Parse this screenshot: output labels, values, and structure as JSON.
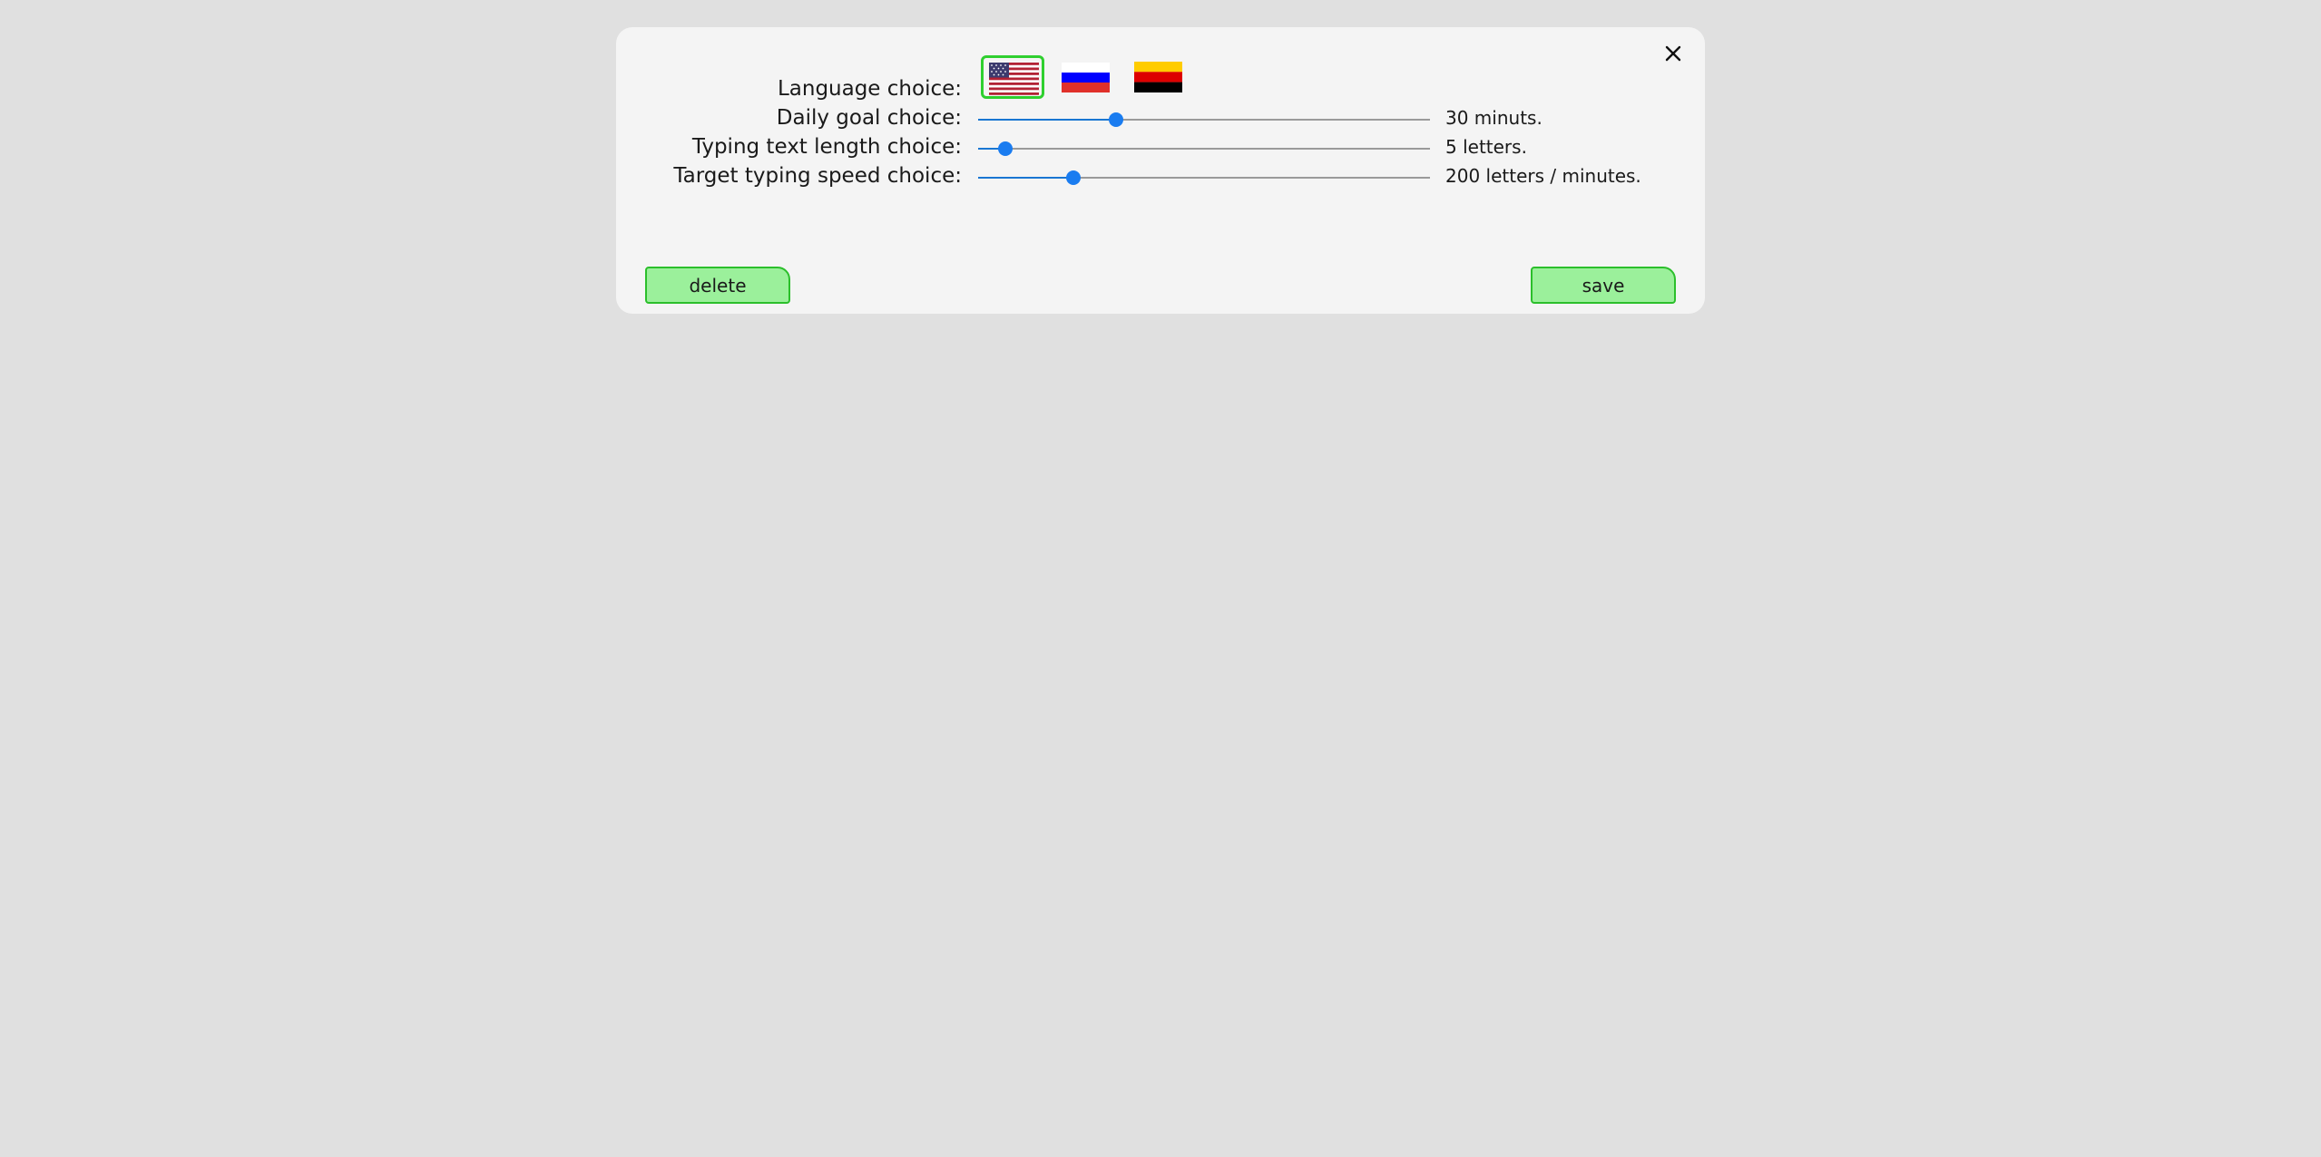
{
  "dialog": {
    "close_icon": "close-icon",
    "language": {
      "label": "Language choice:",
      "options": [
        {
          "name": "english",
          "icon": "us-flag-icon",
          "selected": true
        },
        {
          "name": "russian",
          "icon": "russia-flag-icon",
          "selected": false
        },
        {
          "name": "german",
          "icon": "germany-flag-icon",
          "selected": false
        }
      ]
    },
    "daily_goal": {
      "label": "Daily goal choice:",
      "value_text": "30 minuts.",
      "level_fraction": 0.305
    },
    "text_length": {
      "label": "Typing text length choice:",
      "value_text": "5 letters.",
      "level_fraction": 0.06
    },
    "typing_speed": {
      "label": "Target typing speed choice:",
      "value_text": "200 letters / minutes.",
      "level_fraction": 0.21
    },
    "buttons": {
      "delete_label": "delete",
      "save_label": "save"
    },
    "colors": {
      "accent": "#1a7cf0",
      "button_bg": "#9bf09b",
      "button_border": "#2bbf2b",
      "selected_border": "#2fcf2f"
    }
  }
}
